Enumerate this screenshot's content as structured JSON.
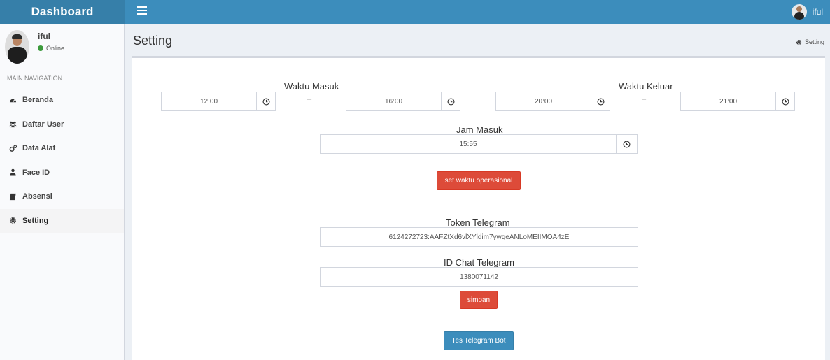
{
  "header": {
    "brand": "Dashboard",
    "user": "iful"
  },
  "sidebar": {
    "user_name": "iful",
    "user_status": "Online",
    "nav_heading": "MAIN NAVIGATION",
    "items": [
      {
        "label": "Beranda",
        "icon": "dashboard-icon"
      },
      {
        "label": "Daftar User",
        "icon": "users-icon"
      },
      {
        "label": "Data Alat",
        "icon": "cogs-icon"
      },
      {
        "label": "Face ID",
        "icon": "user-icon"
      },
      {
        "label": "Absensi",
        "icon": "book-icon"
      },
      {
        "label": "Setting",
        "icon": "gear-icon",
        "active": true
      }
    ]
  },
  "page": {
    "title": "Setting",
    "breadcrumb": "Setting"
  },
  "form": {
    "waktu_masuk_label": "Waktu Masuk",
    "waktu_masuk_start": "12:00",
    "waktu_masuk_end": "16:00",
    "waktu_keluar_label": "Waktu Keluar",
    "waktu_keluar_start": "20:00",
    "waktu_keluar_end": "21:00",
    "range_separator": "–",
    "jam_masuk_label": "Jam Masuk",
    "jam_masuk_value": "15:55",
    "set_button": "set waktu operasional",
    "token_label": "Token Telegram",
    "token_value": "6124272723:AAFZtXd6vlXYldim7ywqeANLoMEIIMOA4zE",
    "chat_label": "ID Chat Telegram",
    "chat_value": "1380071142",
    "save_button": "simpan",
    "test_button": "Tes Telegram Bot"
  },
  "colors": {
    "header": "#3c8dbc",
    "brand": "#367fa9",
    "danger": "#dd4b39",
    "primary": "#3c8dbc",
    "online": "#3c9a3c"
  }
}
